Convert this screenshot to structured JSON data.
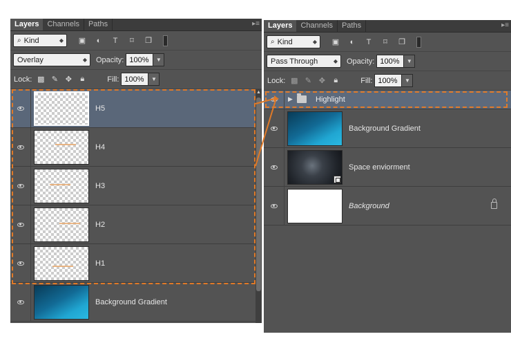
{
  "left_panel": {
    "tabs": [
      "Layers",
      "Channels",
      "Paths"
    ],
    "filter_kind": "Kind",
    "blend_mode": "Overlay",
    "opacity_label": "Opacity:",
    "opacity_value": "100%",
    "lock_label": "Lock:",
    "fill_label": "Fill:",
    "fill_value": "100%",
    "layers": [
      {
        "name": "H5",
        "selected": true,
        "thumb": "checker"
      },
      {
        "name": "H4",
        "selected": false,
        "thumb": "checker"
      },
      {
        "name": "H3",
        "selected": false,
        "thumb": "checker"
      },
      {
        "name": "H2",
        "selected": false,
        "thumb": "checker"
      },
      {
        "name": "H1",
        "selected": false,
        "thumb": "checker"
      },
      {
        "name": "Background Gradient",
        "selected": false,
        "thumb": "blue"
      }
    ]
  },
  "right_panel": {
    "tabs": [
      "Layers",
      "Channels",
      "Paths"
    ],
    "filter_kind": "Kind",
    "blend_mode": "Pass Through",
    "opacity_label": "Opacity:",
    "opacity_value": "100%",
    "lock_label": "Lock:",
    "fill_label": "Fill:",
    "fill_value": "100%",
    "group_name": "Highlight",
    "layers": [
      {
        "name": "Background Gradient",
        "thumb": "blue",
        "italic": false,
        "locked": false
      },
      {
        "name": "Space enviorment",
        "thumb": "space",
        "italic": false,
        "locked": false
      },
      {
        "name": "Background",
        "thumb": "white",
        "italic": true,
        "locked": true
      }
    ]
  },
  "accent_color": "#e07a28",
  "selection_color": "#5a6779"
}
